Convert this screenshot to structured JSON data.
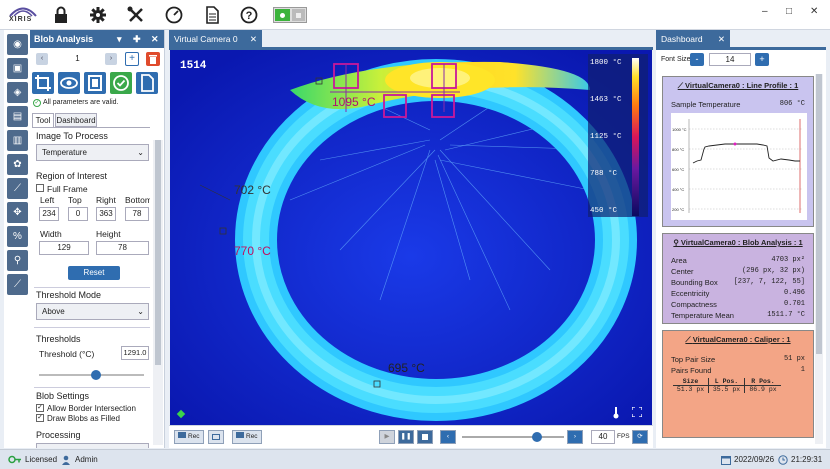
{
  "app": {
    "logo": "XIRIS"
  },
  "toolbar": {
    "icons": [
      "lock-icon",
      "gear-icon",
      "tools-icon",
      "gauge-icon",
      "document-icon",
      "help-icon"
    ],
    "toggle_on": true
  },
  "left_tools": [
    "camera-icon",
    "image-icon",
    "layers-icon",
    "panel-icon",
    "film-icon",
    "palette-icon",
    "line-profile-icon",
    "crosshair-icon",
    "percent-icon",
    "blob-icon",
    "caliper-icon"
  ],
  "blob_panel": {
    "title": "Blob Analysis",
    "index": "1",
    "valid_msg": "All parameters are valid.",
    "tabs": [
      "Tool",
      "Dashboard"
    ],
    "image_to_process_label": "Image To Process",
    "image_to_process_value": "Temperature",
    "roi_label": "Region of Interest",
    "full_frame_label": "Full Frame",
    "roi": {
      "left_label": "Left",
      "top_label": "Top",
      "right_label": "Right",
      "bottom_label": "Bottom",
      "left": "234",
      "top": "0",
      "right": "363",
      "bottom": "78",
      "width_label": "Width",
      "height_label": "Height",
      "width": "129",
      "height": "78"
    },
    "reset_label": "Reset",
    "threshold_mode_label": "Threshold Mode",
    "threshold_mode_value": "Above",
    "thresholds_label": "Thresholds",
    "threshold_c_label": "Threshold (°C)",
    "threshold_c_value": "1291.0",
    "threshold_slider": 0.55,
    "blob_settings_label": "Blob Settings",
    "allow_border_label": "Allow Border Intersection",
    "draw_blobs_label": "Draw Blobs as Filled",
    "processing_label": "Processing"
  },
  "camera": {
    "tab": "Virtual Camera 0",
    "frame": "1514",
    "labels": {
      "t1095": "1095 °C",
      "t702": "702 °C",
      "t770": "770 °C",
      "t695": "695 °C"
    },
    "colorbar": [
      "1800 °C",
      "1463 °C",
      "1125 °C",
      "788 °C",
      "450 °C"
    ],
    "rec1": "Rec",
    "rec2": "Rec",
    "fps": "40",
    "fps_label": "FPS",
    "playback_slider": 0.76
  },
  "dashboard": {
    "tab": "Dashboard",
    "font_size_label": "Font Size",
    "font_size": "14",
    "line_profile": {
      "title": "VirtualCamera0 : Line Profile : 1",
      "sample_label": "Sample Temperature",
      "sample_value": "806 °C",
      "y_ticks": [
        "1000 °C",
        "800 °C",
        "600 °C",
        "400 °C",
        "200 °C"
      ]
    },
    "blob": {
      "title": "VirtualCamera0 : Blob Analysis : 1",
      "rows": [
        [
          "Area",
          "4703 px²"
        ],
        [
          "Center",
          "(296 px, 32 px)"
        ],
        [
          "Bounding Box",
          "[237, 7, 122, 55]"
        ],
        [
          "Eccentricity",
          "0.496"
        ],
        [
          "Compactness",
          "0.701"
        ],
        [
          "Temperature Mean",
          "1511.7 °C"
        ]
      ]
    },
    "caliper": {
      "title": "VirtualCamera0 : Caliper : 1",
      "rows": [
        [
          "Top Pair Size",
          "51 px"
        ],
        [
          "Pairs Found",
          "1"
        ]
      ],
      "table_headers": [
        "Size",
        "L Pos.",
        "R Pos."
      ],
      "table_row": [
        "51.3 px",
        "35.5 px",
        "86.9 px"
      ]
    }
  },
  "status": {
    "licensed": "Licensed",
    "user": "Admin",
    "date": "2022/09/26",
    "time": "21:29:31"
  },
  "colors": {
    "accent": "#3d6a9c",
    "blob_card": "#c9b3e0",
    "line_card": "#c9c4ef",
    "caliper_card": "#f3a586"
  }
}
